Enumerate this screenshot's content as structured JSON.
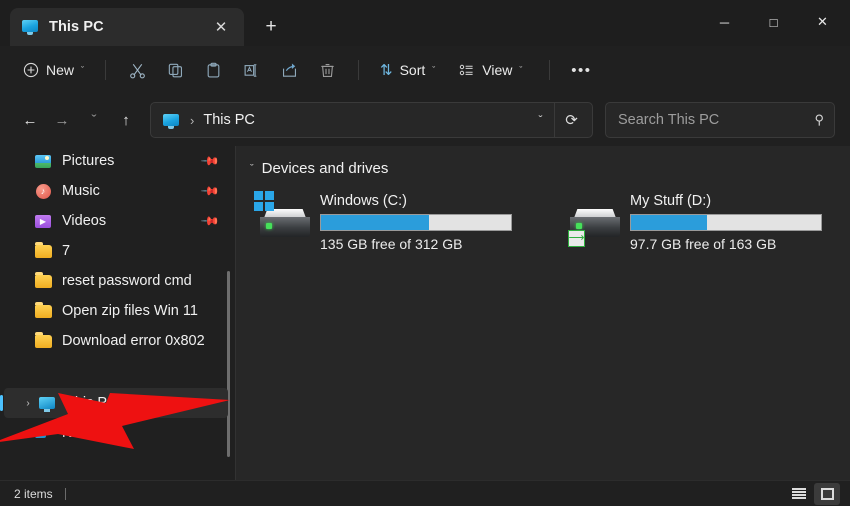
{
  "window": {
    "tab": {
      "title": "This PC",
      "icon": "monitor-icon",
      "close": "✕"
    },
    "new_tab": "+",
    "controls": {
      "minimize": "─",
      "maximize": "□",
      "close": "✕"
    }
  },
  "toolbar": {
    "new_label": "New",
    "new_icon": "plus-circle-icon",
    "cut_icon": "✂",
    "copy_icon": "copy-icon",
    "paste_icon": "paste-icon",
    "rename_icon": "rename-icon",
    "share_icon": "share-icon",
    "delete_icon": "trash-icon",
    "sort_label": "Sort",
    "sort_icon": "⇅",
    "view_label": "View",
    "view_icon": "view-list-icon",
    "more_label": "•••",
    "chevron": "ˇ"
  },
  "address": {
    "back": "←",
    "forward": "→",
    "recent": "ˇ",
    "up": "↑",
    "crumb_icon": "monitor-icon",
    "separator": "›",
    "crumb": "This PC",
    "dropdown": "ˇ",
    "refresh": "⟳"
  },
  "search": {
    "placeholder": "Search This PC",
    "icon": "⚲"
  },
  "sidebar": {
    "items": [
      {
        "label": "Pictures",
        "icon": "pictures-icon",
        "pinned": true,
        "expand": "",
        "selected": false
      },
      {
        "label": "Music",
        "icon": "music-icon",
        "pinned": true,
        "expand": "",
        "selected": false
      },
      {
        "label": "Videos",
        "icon": "videos-icon",
        "pinned": true,
        "expand": "",
        "selected": false
      },
      {
        "label": "7",
        "icon": "folder-icon",
        "pinned": false,
        "expand": "",
        "selected": false
      },
      {
        "label": "reset password cmd",
        "icon": "folder-icon",
        "pinned": false,
        "expand": "",
        "selected": false
      },
      {
        "label": "Open zip files Win 11",
        "icon": "folder-icon",
        "pinned": false,
        "expand": "",
        "selected": false
      },
      {
        "label": "Download error 0x802",
        "icon": "folder-icon",
        "pinned": false,
        "expand": "",
        "selected": false
      },
      {
        "label": "This PC",
        "icon": "this-pc-icon",
        "pinned": false,
        "expand": "›",
        "selected": true
      },
      {
        "label": "Network",
        "icon": "network-icon",
        "pinned": false,
        "expand": "›",
        "selected": false
      }
    ],
    "pin_glyph": "📌"
  },
  "main": {
    "group": {
      "title": "Devices and drives",
      "chevron": "ˇ"
    },
    "drives": [
      {
        "name": "Windows (C:)",
        "capacity_text": "135 GB free of 312 GB",
        "free_gb": 135,
        "total_gb": 312,
        "used_percent": 57,
        "badge": "windows-logo-badge",
        "fill_color": "#2b9ddb"
      },
      {
        "name": "My Stuff (D:)",
        "capacity_text": "97.7 GB free of 163 GB",
        "free_gb": 97.7,
        "total_gb": 163,
        "used_percent": 40,
        "badge": "shared-badge",
        "fill_color": "#2b9ddb"
      }
    ]
  },
  "status": {
    "items_text": "2 items",
    "details_view_icon": "details-view-icon",
    "large_icons_view_icon": "large-icons-view-icon"
  },
  "annotation": {
    "arrow_color": "#ee1111",
    "points_at": "Network"
  }
}
